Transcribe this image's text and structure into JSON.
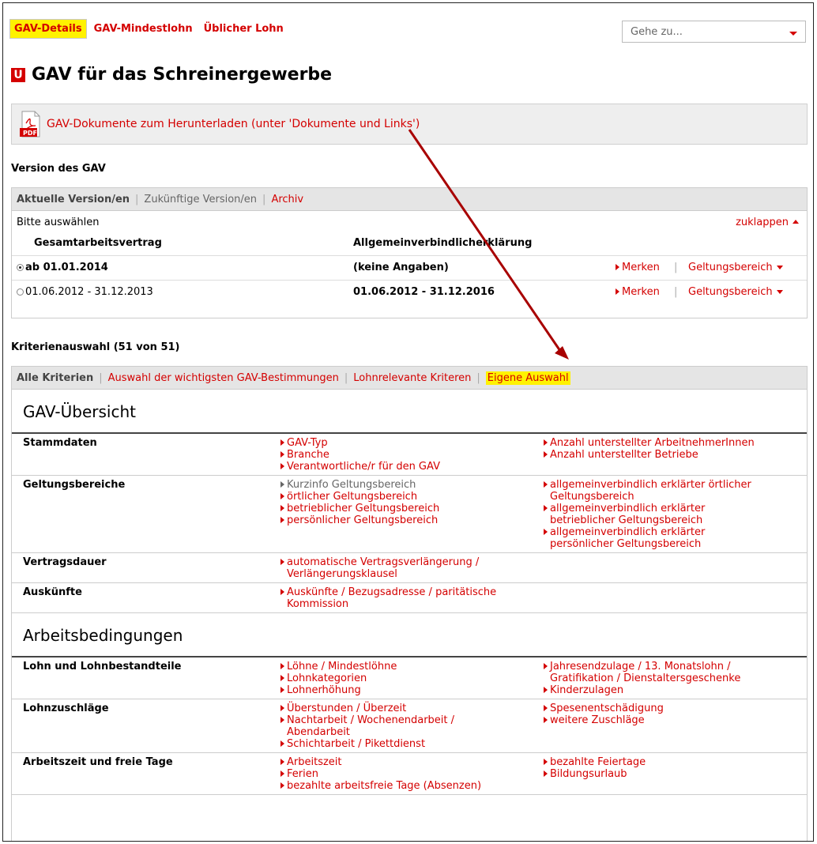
{
  "topnav": {
    "tabs": [
      "GAV-Details",
      "GAV-Mindestlohn",
      "Üblicher Lohn"
    ],
    "goto_placeholder": "Gehe zu..."
  },
  "page_title": "GAV für das Schreinergewerbe",
  "logo_letter": "U",
  "download": {
    "icon": "pdf-icon",
    "pdf_label": "PDF",
    "text": "GAV-Dokumente zum Herunterladen (unter 'Dokumente und Links')"
  },
  "version": {
    "section_title": "Version des GAV",
    "tabs": [
      "Aktuelle Version/en",
      "Zukünftige Version/en",
      "Archiv"
    ],
    "prompt": "Bitte auswählen",
    "collapse": "zuklappen",
    "col_gav": "Gesamtarbeitsvertrag",
    "col_ave": "Allgemeinverbindlicherklärung",
    "rows": [
      {
        "gav": "ab 01.01.2014",
        "ave": "(keine Angaben)",
        "merken": "Merken",
        "scope": "Geltungsbereich"
      },
      {
        "gav": "01.06.2012 - 31.12.2013",
        "ave": "01.06.2012 - 31.12.2016",
        "merken": "Merken",
        "scope": "Geltungsbereich"
      }
    ]
  },
  "criteria": {
    "section_title": "Kriterienauswahl (51 von 51)",
    "tabs": [
      "Alle Kriterien",
      "Auswahl der wichtigsten GAV-Bestimmungen",
      "Lohnrelevante Kriteren",
      "Eigene Auswahl"
    ],
    "groups": [
      {
        "title": "GAV-Übersicht",
        "rows": [
          {
            "label": "Stammdaten",
            "col1": [
              "GAV-Typ",
              "Branche",
              "Verantwortliche/r für den GAV"
            ],
            "col2": [
              "Anzahl unterstellter ArbeitnehmerInnen",
              "Anzahl unterstellter Betriebe"
            ]
          },
          {
            "label": "Geltungsbereiche",
            "col1": [
              "Kurzinfo Geltungsbereich",
              "örtlicher Geltungsbereich",
              "betrieblicher Geltungsbereich",
              "persönlicher Geltungsbereich"
            ],
            "col2": [
              "allgemeinverbindlich erklärter örtlicher|Geltungsbereich",
              "allgemeinverbindlich erklärter|betrieblicher Geltungsbereich",
              "allgemeinverbindlich erklärter|persönlicher Geltungsbereich"
            ]
          },
          {
            "label": "Vertragsdauer",
            "col1": [
              "automatische Vertragsverlängerung /|Verlängerungsklausel"
            ],
            "col2": []
          },
          {
            "label": "Auskünfte",
            "col1": [
              "Auskünfte / Bezugsadresse / paritätische|Kommission"
            ],
            "col2": []
          }
        ]
      },
      {
        "title": "Arbeitsbedingungen",
        "rows": [
          {
            "label": "Lohn und Lohnbestandteile",
            "col1": [
              "Löhne / Mindestlöhne",
              "Lohnkategorien",
              "Lohnerhöhung"
            ],
            "col2": [
              "Jahresendzulage / 13. Monatslohn /|Gratifikation / Dienstaltersgeschenke",
              "Kinderzulagen"
            ]
          },
          {
            "label": "Lohnzuschläge",
            "col1": [
              "Überstunden / Überzeit",
              "Nachtarbeit / Wochenendarbeit /|Abendarbeit",
              "Schichtarbeit / Pikettdienst"
            ],
            "col2": [
              "Spesenentschädigung",
              "weitere Zuschläge"
            ]
          },
          {
            "label": "Arbeitszeit und freie Tage",
            "col1": [
              "Arbeitszeit",
              "Ferien",
              "bezahlte arbeitsfreie Tage (Absenzen)"
            ],
            "col2": [
              "bezahlte Feiertage",
              "Bildungsurlaub"
            ]
          }
        ]
      }
    ]
  },
  "colors": {
    "accent": "#d40000",
    "highlight": "#fff200",
    "arrow": "#a80000"
  }
}
